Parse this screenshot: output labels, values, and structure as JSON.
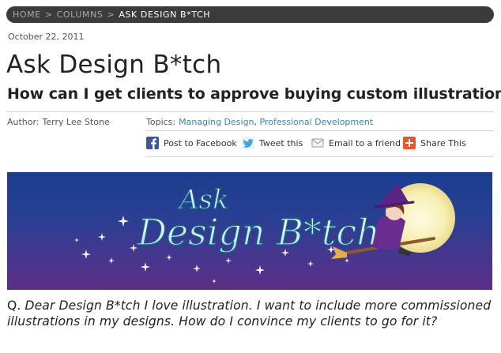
{
  "breadcrumb": {
    "items": [
      "HOME",
      "COLUMNS"
    ],
    "separator": ">",
    "current": "ASK DESIGN B*TCH"
  },
  "article": {
    "date": "October 22, 2011",
    "title": "Ask Design B*tch",
    "subtitle": "How can I get clients to approve buying custom illustrations?",
    "author_label": "Author:",
    "author": "Terry Lee Stone",
    "topics_label": "Topics:",
    "topics": [
      "Managing Design",
      "Professional Development"
    ],
    "topics_separator": ","
  },
  "share": {
    "facebook": "Post to Facebook",
    "twitter": "Tweet this",
    "email": "Email to a friend",
    "share": "Share This"
  },
  "banner": {
    "line1": "Ask",
    "line2": "Design B*tch"
  },
  "question": {
    "prefix": "Q.",
    "text": "Dear Design B*tch I love illustration. I want to include more commissioned illustrations in my designs. How do I convince my clients to go for it?"
  },
  "colors": {
    "breadcrumb_bg": "#3b3b3b",
    "link": "#3a86b3",
    "facebook": "#3b5998",
    "twitter": "#4aa3df",
    "share": "#e8562a",
    "banner_top": "#1b3e8f",
    "banner_bottom": "#5b2f86"
  },
  "icons": {
    "facebook": "facebook-icon",
    "twitter": "twitter-bird-icon",
    "email": "envelope-icon",
    "share": "plus-share-icon"
  }
}
